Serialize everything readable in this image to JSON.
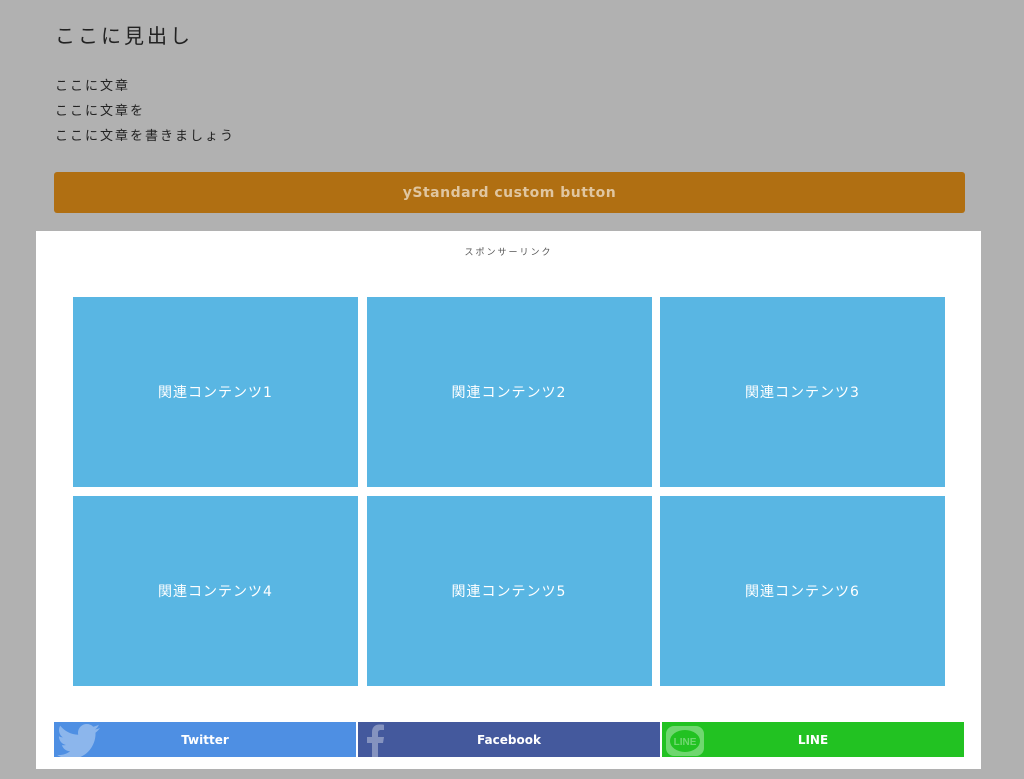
{
  "heading": "ここに見出し",
  "paragraph": {
    "lines": [
      "ここに文章",
      "ここに文章を",
      "ここに文章を書きましょう"
    ]
  },
  "custom_button": {
    "label": "yStandard custom button",
    "color": "#b06f12"
  },
  "sponsor": {
    "label": "スポンサーリンク"
  },
  "related": {
    "items": [
      {
        "label": "関連コンテンツ1"
      },
      {
        "label": "関連コンテンツ2"
      },
      {
        "label": "関連コンテンツ3"
      },
      {
        "label": "関連コンテンツ4"
      },
      {
        "label": "関連コンテンツ5"
      },
      {
        "label": "関連コンテンツ6"
      }
    ],
    "tile_color": "#59b6e3"
  },
  "share": {
    "twitter": {
      "label": "Twitter",
      "icon": "twitter-bird-icon",
      "color": "#4e8fe3"
    },
    "facebook": {
      "label": "Facebook",
      "icon": "facebook-f-icon",
      "color": "#44599d"
    },
    "line": {
      "label": "LINE",
      "icon": "line-bubble-icon",
      "color": "#22c222"
    }
  }
}
